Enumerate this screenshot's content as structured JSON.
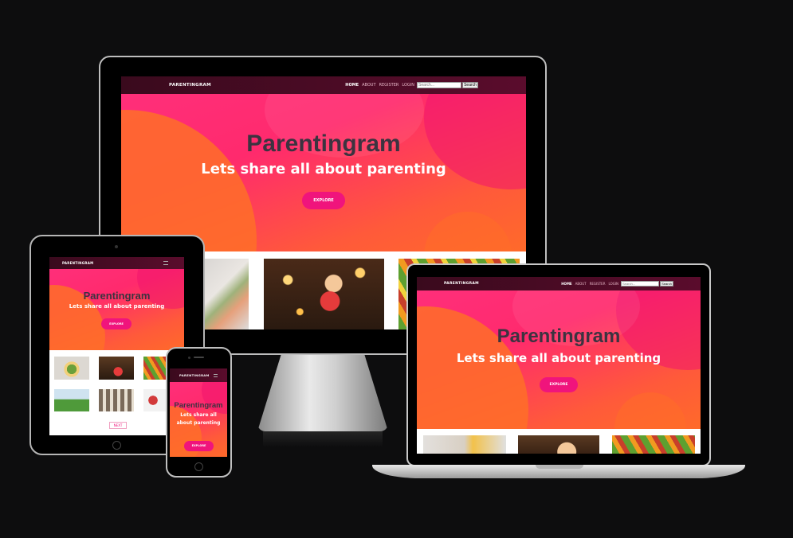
{
  "site": {
    "brand": "PARENTINGRAM",
    "nav": [
      "HOME",
      "ABOUT",
      "REGISTER",
      "LOGIN"
    ],
    "search_placeholder": "Search...",
    "search_button": "Search",
    "hero_title": "Parentingram",
    "hero_subtitle": "Lets share all about parenting",
    "explore_button": "EXPLORE",
    "next_link": "NEXT"
  },
  "colors": {
    "nav": "#4a0b24",
    "accent": "#f0147c",
    "hero_pink": "#ff2a6d",
    "hero_orange": "#ff6a2a"
  },
  "thumbnails": [
    "snack-photo",
    "child-gift-photo",
    "vegetables-photo",
    "kids-field-photo",
    "stripes-photo",
    "toy-photo"
  ]
}
